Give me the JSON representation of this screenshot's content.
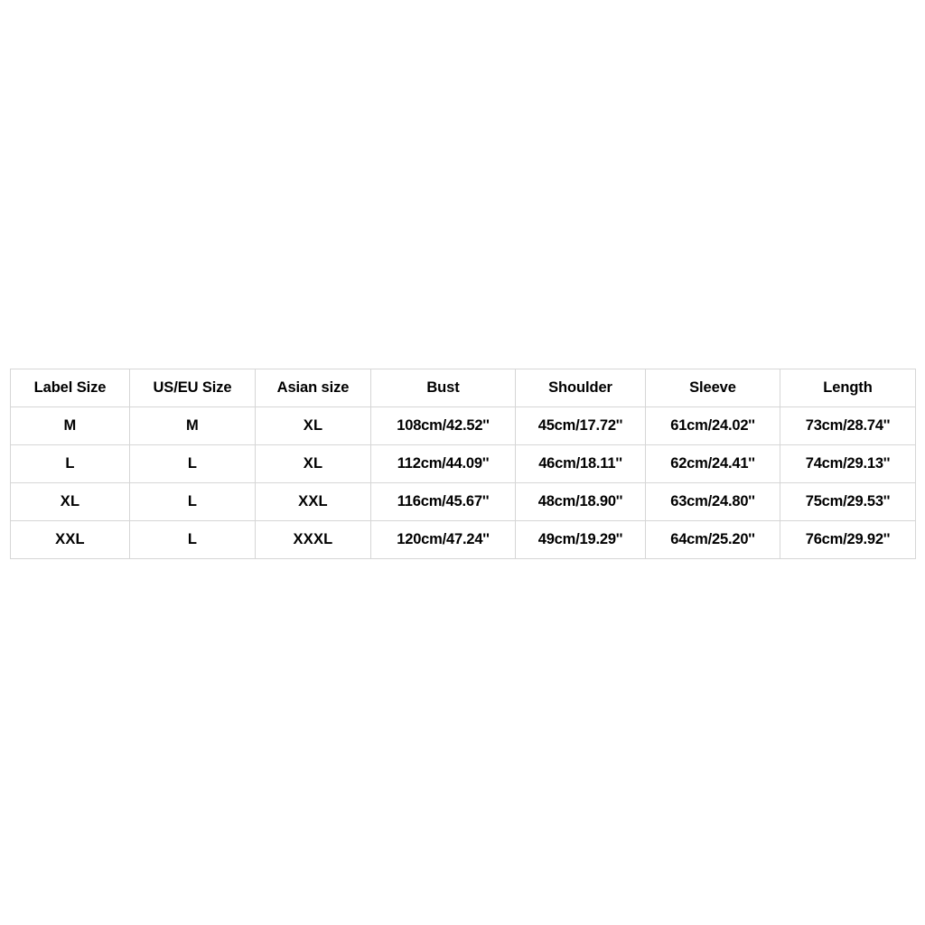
{
  "table": {
    "name": "garment-size-chart",
    "border_color": "#d6d6d6",
    "text_color": "#000000",
    "background_color": "#ffffff",
    "headers": [
      "Label Size",
      "US/EU Size",
      "Asian size",
      "Bust",
      "Shoulder",
      "Sleeve",
      "Length"
    ],
    "rows": [
      {
        "label_size": "M",
        "us_eu_size": "M",
        "asian_size": "XL",
        "bust": "108cm/42.52''",
        "shoulder": "45cm/17.72''",
        "sleeve": "61cm/24.02''",
        "length": "73cm/28.74''"
      },
      {
        "label_size": "L",
        "us_eu_size": "L",
        "asian_size": "XL",
        "bust": "112cm/44.09''",
        "shoulder": "46cm/18.11''",
        "sleeve": "62cm/24.41''",
        "length": "74cm/29.13''"
      },
      {
        "label_size": "XL",
        "us_eu_size": "L",
        "asian_size": "XXL",
        "bust": "116cm/45.67''",
        "shoulder": "48cm/18.90''",
        "sleeve": "63cm/24.80''",
        "length": "75cm/29.53''"
      },
      {
        "label_size": "XXL",
        "us_eu_size": "L",
        "asian_size": "XXXL",
        "bust": "120cm/47.24''",
        "shoulder": "49cm/19.29''",
        "sleeve": "64cm/25.20''",
        "length": "76cm/29.92''"
      }
    ]
  }
}
